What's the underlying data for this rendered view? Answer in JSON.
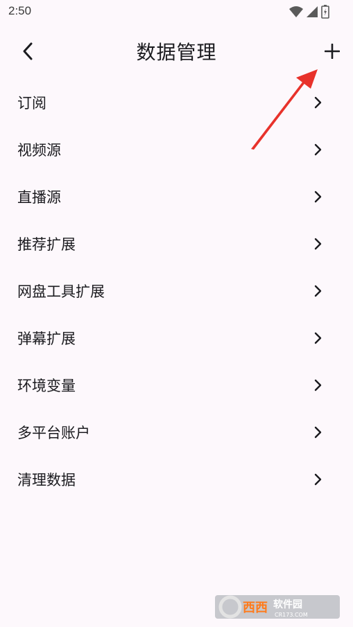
{
  "status_bar": {
    "time": "2:50",
    "icons": [
      "wifi-icon",
      "signal-icon",
      "battery-icon"
    ]
  },
  "header": {
    "title": "数据管理",
    "back_icon": "chevron-left-icon",
    "add_icon": "plus-icon"
  },
  "menu": {
    "items": [
      {
        "label": "订阅"
      },
      {
        "label": "视频源"
      },
      {
        "label": "直播源"
      },
      {
        "label": "推荐扩展"
      },
      {
        "label": "网盘工具扩展"
      },
      {
        "label": "弹幕扩展"
      },
      {
        "label": "环境变量"
      },
      {
        "label": "多平台账户"
      },
      {
        "label": "清理数据"
      }
    ]
  },
  "watermark": {
    "brand": "西西软件园",
    "url": "CR173.COM"
  },
  "colors": {
    "background": "#fdf8fc",
    "text": "#1b1b1f",
    "annotation_arrow": "#e8322b"
  }
}
